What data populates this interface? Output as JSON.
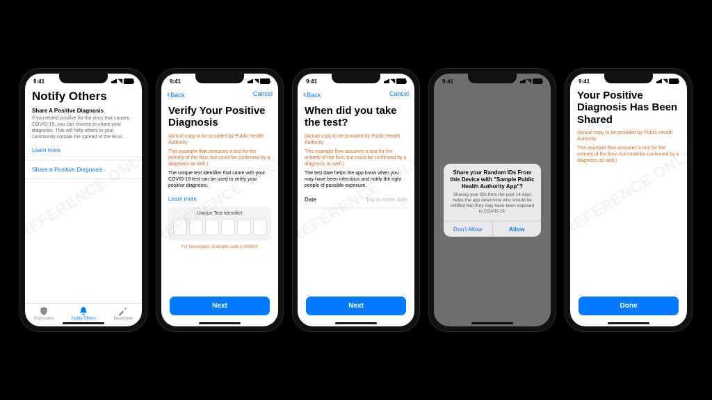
{
  "watermark": "REFERENCE ONLY",
  "status": {
    "time": "9:41"
  },
  "nav": {
    "back": "Back",
    "cancel": "Cancel"
  },
  "buttons": {
    "next": "Next",
    "done": "Done"
  },
  "screen1": {
    "title": "Notify Others",
    "subhead": "Share A Positive Diagnosis",
    "body": "If you tested positive for the virus that causes COVID-19, you can choose to share your diagnosis. This will help others in your community contain the spread of the virus.",
    "learn": "Learn more",
    "row": "Share a Positive Diagnosis",
    "tabs": [
      "Exposures",
      "Notify Others",
      "Developer"
    ]
  },
  "screen2": {
    "title": "Verify Your Positive Diagnosis",
    "note1": "(Actual copy to be provided by Public Health Authority",
    "note2": "This example flow assumes a test for the entirety of the flow, but could be confirmed by a diagnosis as well.)",
    "body": "The unique test identifier that came with your COVID-19 test can be used to verify your positive diagnosis.",
    "learn": "Learn more",
    "codeLabel": "Unique Test Identifier",
    "devnote": "For Developers: Example code is 000000"
  },
  "screen3": {
    "title": "When did you take the test?",
    "note1": "(Actual copy to be provided by Public Health Authority",
    "note2": "This example flow assumes a test for the entirety of the flow, but could be confirmed by a diagnosis as well.)",
    "body": "The test date helps the app know when you may have been infectious and notify the right people of possible exposure.",
    "dateLabel": "Date",
    "datePlaceholder": "Tap to enter date"
  },
  "screen4": {
    "alertTitle": "Share your Random IDs From this Device with \"Sample Public Health Authority App\"?",
    "alertBody": "Sharing your IDs from the past 14 days helps the app determine who should be notified that they may have been exposed to COVID-19.",
    "deny": "Don't Allow",
    "allow": "Allow"
  },
  "screen5": {
    "title": "Your Positive Diagnosis Has Been Shared",
    "note1": "(Actual copy to be provided by Public Health Authority",
    "note2": "This example flow assumes a test for the entirety of the flow, but could be confirmed by a diagnosis as well.)"
  }
}
